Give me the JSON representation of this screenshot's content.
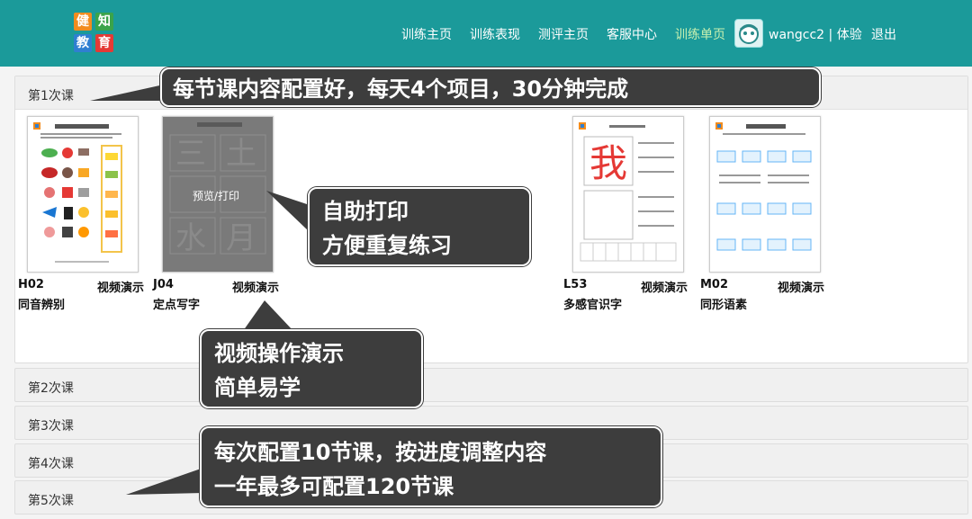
{
  "logo": {
    "chars": [
      "健",
      "知",
      "教",
      "育"
    ],
    "colors": [
      "#f28c1e",
      "#3aa34a",
      "#2f7fd1",
      "#e53935"
    ]
  },
  "nav": {
    "items": [
      "训练主页",
      "训练表现",
      "测评主页",
      "客服中心",
      "训练单页"
    ],
    "user": "wangcc2 | 体验",
    "logout": "退出"
  },
  "lessons": [
    {
      "title": "第1次课"
    },
    {
      "title": "第2次课"
    },
    {
      "title": "第3次课"
    },
    {
      "title": "第4次课"
    },
    {
      "title": "第5次课"
    }
  ],
  "cards": [
    {
      "code": "H02",
      "name": "同音辨别",
      "demo": "视频演示"
    },
    {
      "code": "J04",
      "name": "定点写字",
      "demo": "视频演示",
      "overlay": "预览/打印"
    },
    {
      "code": "L53",
      "name": "多感官识字",
      "demo": "视频演示"
    },
    {
      "code": "M02",
      "name": "同形语素",
      "demo": "视频演示"
    }
  ],
  "callouts": {
    "top": "每节课内容配置好，每天4个项目，30分钟完成",
    "print": [
      "自助打印",
      "方便重复练习"
    ],
    "video": [
      "视频操作演示",
      "简单易学"
    ],
    "config": [
      "每次配置10节课，按进度调整内容",
      "一年最多可配置120节课"
    ]
  },
  "colors": {
    "header": "#1b9a9a",
    "callout": "#3d3d3d"
  }
}
